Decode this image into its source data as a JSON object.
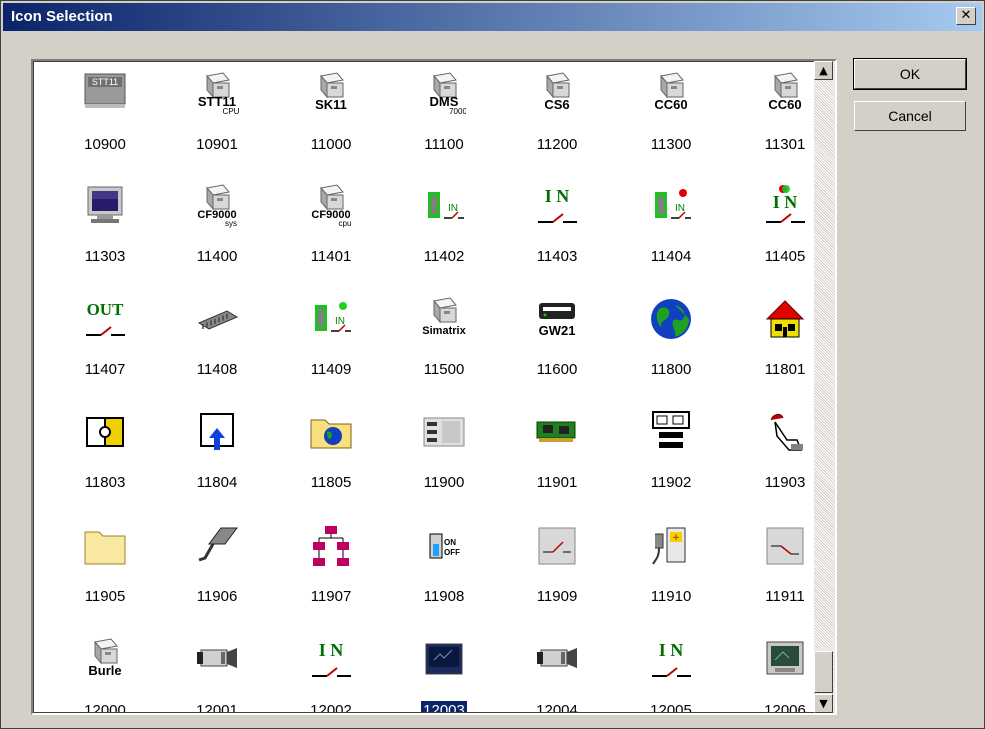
{
  "window": {
    "title": "Icon Selection",
    "close_glyph": "✕"
  },
  "buttons": {
    "ok": "OK",
    "cancel": "Cancel"
  },
  "scrollbar": {
    "up_glyph": "▲",
    "down_glyph": "▼"
  },
  "selected_id": "12003",
  "icons": [
    {
      "id": "10900",
      "icon": "stt11-box-icon",
      "text": "STT11"
    },
    {
      "id": "10901",
      "icon": "device-stt11-cpu-icon",
      "text": "STT11",
      "sub": "CPU"
    },
    {
      "id": "11000",
      "icon": "device-sk11-icon",
      "text": "SK11"
    },
    {
      "id": "11100",
      "icon": "device-dms-icon",
      "text": "DMS",
      "sub": "7000"
    },
    {
      "id": "11200",
      "icon": "device-cs6-icon",
      "text": "CS6"
    },
    {
      "id": "11300",
      "icon": "device-cc60-icon",
      "text": "CC60"
    },
    {
      "id": "11301",
      "icon": "device-cc60-icon",
      "text": "CC60"
    },
    {
      "id": "11303",
      "icon": "monitor-icon"
    },
    {
      "id": "11400",
      "icon": "device-cf9000-sys-icon",
      "text": "CF9000",
      "sub": "sys"
    },
    {
      "id": "11401",
      "icon": "device-cf9000-cpu-icon",
      "text": "CF9000",
      "sub": "cpu"
    },
    {
      "id": "11402",
      "icon": "input-module-icon",
      "text": "IN"
    },
    {
      "id": "11403",
      "icon": "input-switch-icon",
      "text": "I N"
    },
    {
      "id": "11404",
      "icon": "input-module-red-icon",
      "text": "IN"
    },
    {
      "id": "11405",
      "icon": "input-switch-led-icon",
      "text": "I N"
    },
    {
      "id": "11407",
      "icon": "output-switch-icon",
      "text": "OUT"
    },
    {
      "id": "11408",
      "icon": "chip-icon"
    },
    {
      "id": "11409",
      "icon": "input-module-green-icon",
      "text": "IN"
    },
    {
      "id": "11500",
      "icon": "device-simatrix-icon",
      "text": "Simatrix"
    },
    {
      "id": "11600",
      "icon": "gateway-gw21-icon",
      "text": "GW21"
    },
    {
      "id": "11800",
      "icon": "globe-icon"
    },
    {
      "id": "11801",
      "icon": "house-icon"
    },
    {
      "id": "11803",
      "icon": "puzzle-icon"
    },
    {
      "id": "11804",
      "icon": "upload-arrow-icon"
    },
    {
      "id": "11805",
      "icon": "folder-globe-icon"
    },
    {
      "id": "11900",
      "icon": "rack-panel-icon"
    },
    {
      "id": "11901",
      "icon": "network-card-icon"
    },
    {
      "id": "11902",
      "icon": "patch-panel-icon"
    },
    {
      "id": "11903",
      "icon": "hand-pointer-icon"
    },
    {
      "id": "11905",
      "icon": "folder-icon"
    },
    {
      "id": "11906",
      "icon": "cable-connector-icon"
    },
    {
      "id": "11907",
      "icon": "network-tree-icon"
    },
    {
      "id": "11908",
      "icon": "on-off-switch-icon",
      "text": "ON",
      "sub": "OFF"
    },
    {
      "id": "11909",
      "icon": "switch-open-icon"
    },
    {
      "id": "11910",
      "icon": "battery-plug-icon"
    },
    {
      "id": "11911",
      "icon": "switch-closed-icon"
    },
    {
      "id": "12000",
      "icon": "device-burle-icon",
      "text": "Burle"
    },
    {
      "id": "12001",
      "icon": "camera-icon"
    },
    {
      "id": "12002",
      "icon": "input-switch-icon",
      "text": "I N"
    },
    {
      "id": "12003",
      "icon": "screen-dark-icon"
    },
    {
      "id": "12004",
      "icon": "camera-icon"
    },
    {
      "id": "12005",
      "icon": "input-switch-icon",
      "text": "I N"
    },
    {
      "id": "12006",
      "icon": "display-monitor-icon"
    }
  ]
}
